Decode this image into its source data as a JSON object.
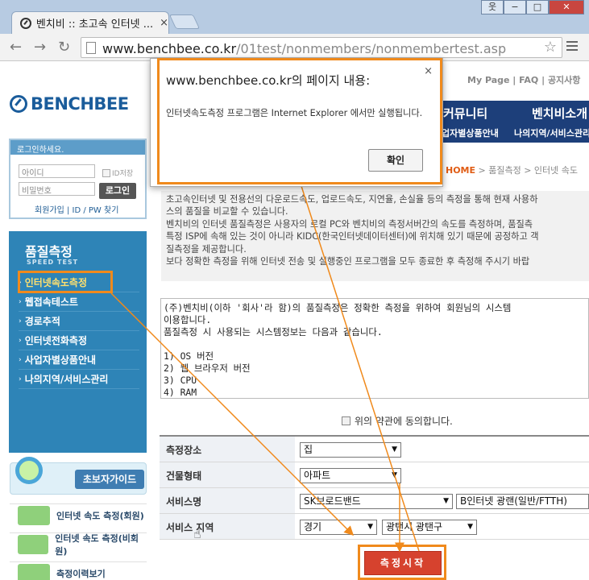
{
  "browser": {
    "tab_title": "벤치비 :: 초고속 인터넷 ...",
    "tab_close": "×",
    "url_host": "www.benchbee.co.kr",
    "url_path": "/01test/nonmembers/nonmembertest.asp",
    "window_buttons": [
      "웃",
      "−",
      "□",
      "✕"
    ]
  },
  "site": {
    "logo": "BENCHBEE",
    "top_links": "My Page  |  FAQ  |  공지사항",
    "gnb": {
      "menu1": "커뮤니티",
      "menu2": "벤치비소개",
      "sub1": "업자별상품안내",
      "sub2": "나의지역/서비스관리"
    },
    "breadcrumb": {
      "home": "HOME",
      "rest": " >  품질측정  >  인터넷 속도"
    }
  },
  "login": {
    "header": "로그인하세요.",
    "id_placeholder": "아이디",
    "pw_placeholder": "비밀번호",
    "remember": "ID저장",
    "login_button": "로그인",
    "links": "회원가입  |  ID / PW 찾기"
  },
  "sidemenu": {
    "title": "품질측정",
    "subtitle": "SPEED TEST",
    "items": [
      "인터넷속도측정",
      "웹접속테스트",
      "경로추적",
      "인터넷전화측정",
      "사업자별상품안내",
      "나의지역/서비스관리"
    ]
  },
  "guide": {
    "label": "초보자가이드"
  },
  "quick_links": [
    "인터넷 속도 측정(회원)",
    "인터넷 속도 측정(비회원)",
    "측정이력보기"
  ],
  "description": [
    "초고속인터넷 및 전용선의 다운로드속도, 업로드속도, 지연율, 손실율 등의 측정을 통해 현재 사용하",
    "스의 품질을 비교할 수 있습니다.",
    "벤치비의 인터넷 품질측정은 사용자의 로컬 PC와 벤치비의 측정서버간의 속도를 측정하며, 품질측",
    "특정 ISP에 속해 있는 것이 아니라 KIDC(한국인터넷데이터센터)에 위치해 있기 때문에 공정하고 객",
    "질측정을 제공합니다.",
    "보다 정확한 측정을 위해 인터넷 전송 및 실행중인 프로그램을 모두 종료한 후 측정해 주시기 바랍"
  ],
  "terms": [
    "(주)벤치비(이하 '회사'라 함)의 품질측정은 정확한 측정을 위하여 회원님의 시스템",
    "이용합니다.",
    "품질측정 시 사용되는 시스템정보는 다음과 같습니다.",
    "",
    "1) OS 버전",
    "2) 웹 브라우저 버전",
    "3) CPU",
    "4) RAM"
  ],
  "agree_label": "위의 약관에 동의합니다.",
  "form": {
    "location": {
      "label": "측정장소",
      "value": "집"
    },
    "housing": {
      "label": "건물형태",
      "value": "아파트"
    },
    "service": {
      "label": "서비스명",
      "value": "SK브로드밴드",
      "value2": "B인터넷 광랜(일반/FTTH)"
    },
    "region": {
      "label": "서비스 지역",
      "value": "경기",
      "value2": "광탠시 광탠구"
    }
  },
  "start_button": "측정시작",
  "dialog": {
    "title": "www.benchbee.co.kr의 페이지 내용:",
    "close": "×",
    "message": "인터넷속도측정 프로그램은 Internet Explorer 에서만 실행됩니다.",
    "ok": "확인"
  },
  "colors": {
    "accent_highlight": "#f08a1c",
    "brand_blue": "#1a5c9b",
    "menu_blue": "#2e84b7",
    "start_red": "#d6422e"
  }
}
